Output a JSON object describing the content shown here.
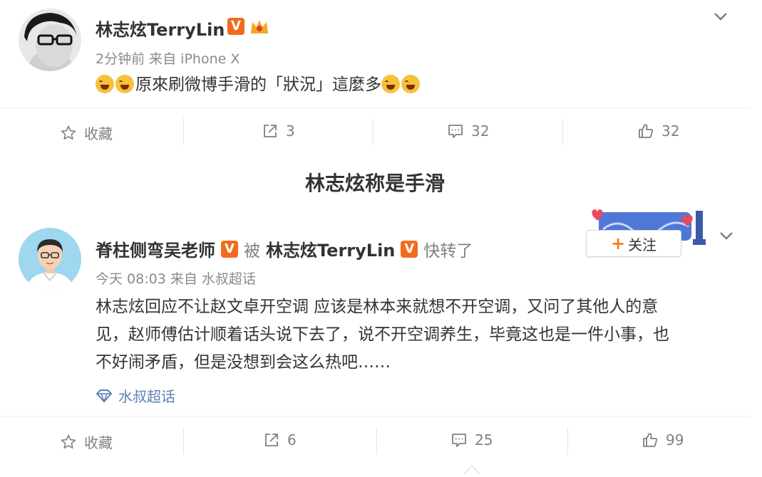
{
  "post1": {
    "author": "林志炫TerryLin",
    "v_badge": "V",
    "meta": "2分钟前 来自 iPhone X",
    "text": "原來刷微博手滑的「狀況」這麼多",
    "actions": {
      "favorite": "收藏",
      "repost": "3",
      "comment": "32",
      "like": "32"
    }
  },
  "caption": "林志炫称是手滑",
  "post2": {
    "author": "脊柱侧弯吴老师",
    "v_badge": "V",
    "by": "被",
    "repost_author": "林志炫TerryLin",
    "repost_author_badge": "V",
    "reposted": "快转了",
    "meta": "今天 08:03 来自 水叔超话",
    "follow": "关注",
    "follow_plus": "+",
    "text_lines": [
      "林志炫回应不让赵文卓开空调 应该是林本来就想不开空调，又问了其他人的意",
      "见，赵师傅估计顺着话头说下去了，说不开空调养生，毕竟这也是一件小事，也",
      "不好闹矛盾，但是没想到会这么热吧……"
    ],
    "topic": "水叔超话",
    "actions": {
      "favorite": "收藏",
      "repost": "6",
      "comment": "25",
      "like": "99"
    }
  },
  "colors": {
    "badge": "#f26b1d",
    "follow_plus": "#ff7a1a",
    "topic": "#5b7fb3"
  }
}
